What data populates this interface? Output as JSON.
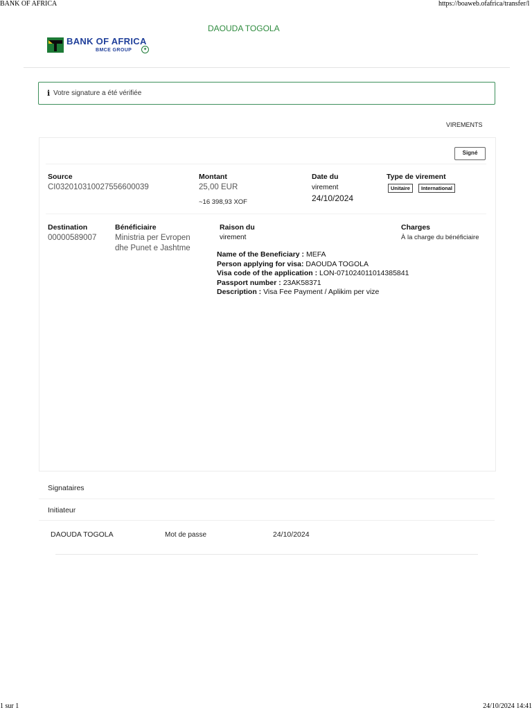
{
  "print_header": {
    "left": "BANK OF AFRICA",
    "right": "https://boaweb.ofafrica/transfer/l"
  },
  "print_footer": {
    "left": "1 sur 1",
    "right": "24/10/2024 14:41"
  },
  "header": {
    "user_name": "DAOUDA TOGOLA",
    "logo": {
      "title": "BANK OF AFRICA",
      "subtitle": "BMCE GROUP"
    }
  },
  "alert": {
    "icon": "info-icon",
    "text": "Votre signature a été vérifiée"
  },
  "nav": {
    "transfers_link": "VIREMENTS"
  },
  "transfer": {
    "status_button": "Signé",
    "source": {
      "label": "Source",
      "value": "CI032010310027556600039"
    },
    "amount": {
      "label": "Montant",
      "value": "25,00 EUR",
      "converted": "~16 398,93 XOF"
    },
    "date": {
      "label_line1": "Date du",
      "label_line2": "virement",
      "value": "24/10/2024"
    },
    "type": {
      "label": "Type de virement",
      "tags": [
        "Unitaire",
        "International"
      ]
    },
    "destination": {
      "label": "Destination",
      "value": "00000589007"
    },
    "beneficiary": {
      "label": "Bénéficiaire",
      "line1": "Ministria per Evropen",
      "line2": "dhe Punet e Jashtme"
    },
    "reason": {
      "label_line1": "Raison du",
      "label_line2": "virement",
      "lines": [
        {
          "key": "Name of the Beneficiary :",
          "value": " MEFA"
        },
        {
          "key": "Person applying for visa:",
          "value": " DAOUDA TOGOLA"
        },
        {
          "key": "Visa code of the application :",
          "value": " LON-071024011014385841"
        },
        {
          "key": "Passport number :",
          "value": " 23AK58371"
        },
        {
          "key": "Description :",
          "value": " Visa Fee Payment / Aplikim per vize"
        }
      ]
    },
    "charges": {
      "label": "Charges",
      "value": "À la charge du bénéficiaire"
    }
  },
  "signatories": {
    "title": "Signataires",
    "initiator_title": "Initiateur",
    "rows": [
      {
        "name": "DAOUDA TOGOLA",
        "method": "Mot de passe",
        "date": "24/10/2024"
      }
    ]
  }
}
